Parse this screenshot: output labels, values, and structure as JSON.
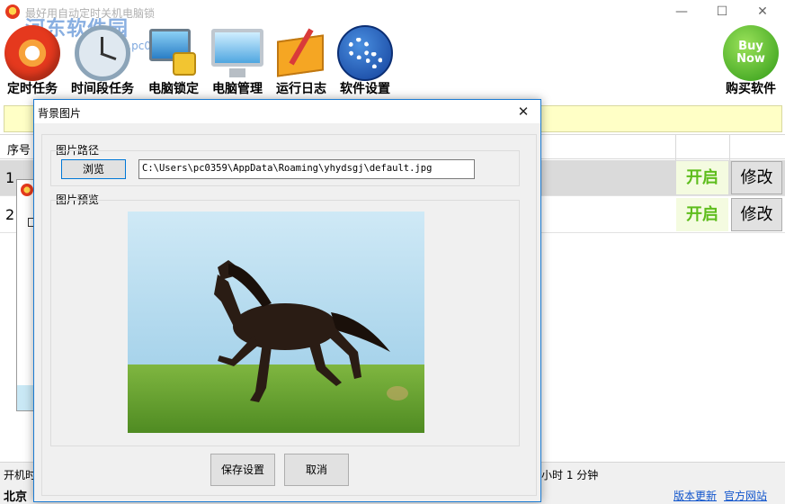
{
  "app": {
    "title": "最好用自动定时关机电脑锁",
    "watermark_brand": "河东软件园",
    "watermark_url": "www.pc0359.cn",
    "window_controls": {
      "minimize": "—",
      "maximize": "☐",
      "close": "✕"
    }
  },
  "toolbar": {
    "items": [
      {
        "label": "定时任务",
        "icon": "timer-icon"
      },
      {
        "label": "时间段任务",
        "icon": "clock-icon"
      },
      {
        "label": "电脑锁定",
        "icon": "computer-lock-icon"
      },
      {
        "label": "电脑管理",
        "icon": "monitor-icon"
      },
      {
        "label": "运行日志",
        "icon": "logbook-icon"
      },
      {
        "label": "软件设置",
        "icon": "gears-icon"
      }
    ],
    "buy": {
      "label": "购买软件",
      "badge_line1": "Buy",
      "badge_line2": "Now"
    }
  },
  "table": {
    "header_index": "序号",
    "rows": [
      {
        "index": "1",
        "status": "开启",
        "edit": "修改"
      },
      {
        "index": "2",
        "status": "开启",
        "edit": "修改"
      }
    ]
  },
  "status": {
    "line1_left": "开机时",
    "line1_right": "小时 1 分钟",
    "line2_left": "北京",
    "link_update": "版本更新",
    "link_site": "官方网站"
  },
  "dialog": {
    "title": "背景图片",
    "close": "✕",
    "path_section_label": "图片路径",
    "browse_label": "浏览",
    "path_value": "C:\\Users\\pc0359\\AppData\\Roaming\\yhydsgj\\default.jpg",
    "preview_section_label": "图片预览",
    "save_label": "保存设置",
    "cancel_label": "取消"
  },
  "colors": {
    "accent_blue": "#1b7ad1",
    "status_on_green": "#5ebd1c",
    "band_yellow": "#ffffc6",
    "link_blue": "#1155cc"
  }
}
